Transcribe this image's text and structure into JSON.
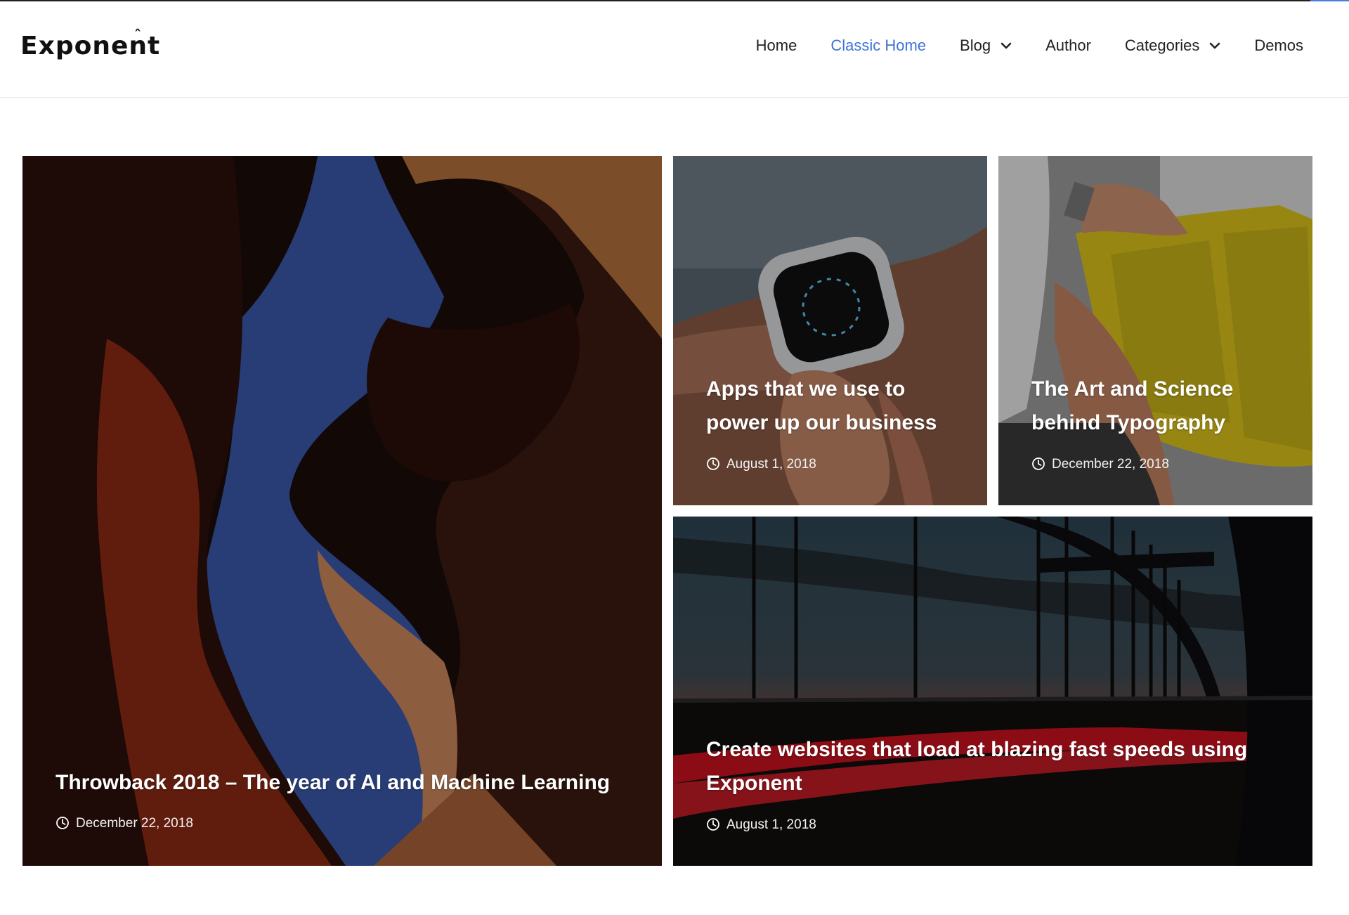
{
  "header": {
    "logo": "Exponent",
    "nav": [
      {
        "label": "Home",
        "active": false,
        "dropdown": false
      },
      {
        "label": "Classic Home",
        "active": true,
        "dropdown": false
      },
      {
        "label": "Blog",
        "active": false,
        "dropdown": true
      },
      {
        "label": "Author",
        "active": false,
        "dropdown": false
      },
      {
        "label": "Categories",
        "active": false,
        "dropdown": true
      },
      {
        "label": "Demos",
        "active": false,
        "dropdown": false
      }
    ]
  },
  "posts": [
    {
      "title": "Throwback 2018 – The year of AI and Machine Learning",
      "date": "December 22, 2018",
      "image": "canyon-sky"
    },
    {
      "title": "Apps that we use to power up our business",
      "date": "August 1, 2018",
      "image": "smartwatch-wrist"
    },
    {
      "title": "The Art and Science behind Typography",
      "date": "December 22, 2018",
      "image": "yellow-book"
    },
    {
      "title": "Create websites that load at blazing fast speeds using Exponent",
      "date": "August 1, 2018",
      "image": "bridge-light-trails"
    }
  ],
  "colors": {
    "accent": "#3e73d6",
    "text": "#222222"
  }
}
